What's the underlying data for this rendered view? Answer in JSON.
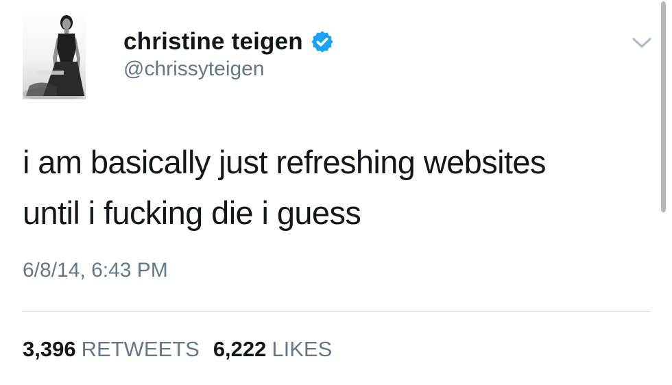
{
  "user": {
    "display_name": "christine teigen",
    "handle": "@chrissyteigen",
    "verified": true
  },
  "tweet": {
    "text_line1": "i am basically just refreshing websites",
    "text_line2": "until i fucking die i guess",
    "timestamp": "6/8/14, 6:43 PM"
  },
  "stats": {
    "retweets_count": "3,396",
    "retweets_label": "RETWEETS",
    "likes_count": "6,222",
    "likes_label": "LIKES"
  },
  "colors": {
    "verified_blue": "#1da1f2",
    "secondary_text": "#657786",
    "primary_text": "#14171a"
  },
  "icons": {
    "verified": "verified-badge-icon",
    "menu": "chevron-down-icon"
  }
}
